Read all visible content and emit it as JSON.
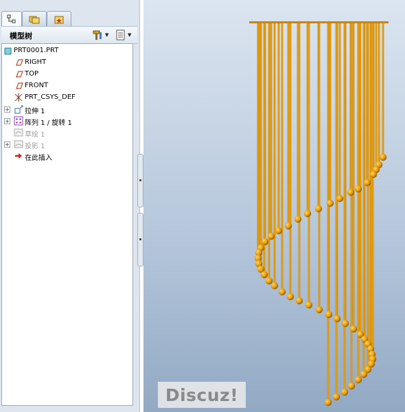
{
  "tabs": [
    {
      "name": "model-tree-tab",
      "icon": "model-tree-icon"
    },
    {
      "name": "folder-browser-tab",
      "icon": "folder-icon"
    },
    {
      "name": "favorites-tab",
      "icon": "favorites-icon"
    }
  ],
  "tree_header": {
    "title": "模型树",
    "settings_icon": "hammer-settings-icon",
    "show_icon": "show-list-icon"
  },
  "tree": {
    "items": [
      {
        "label": "PRT0001.PRT",
        "icon": "part-icon",
        "expander": false,
        "dimmed": false
      },
      {
        "label": "RIGHT",
        "icon": "datum-plane-icon",
        "expander": false,
        "dimmed": false
      },
      {
        "label": "TOP",
        "icon": "datum-plane-icon",
        "expander": false,
        "dimmed": false
      },
      {
        "label": "FRONT",
        "icon": "datum-plane-icon",
        "expander": false,
        "dimmed": false
      },
      {
        "label": "PRT_CSYS_DEF",
        "icon": "csys-icon",
        "expander": false,
        "dimmed": false
      },
      {
        "label": "拉伸 1",
        "icon": "extrude-icon",
        "expander": true,
        "dimmed": false
      },
      {
        "label": "阵列 1 / 旋转 1",
        "icon": "pattern-icon",
        "expander": true,
        "dimmed": false
      },
      {
        "label": "草绘 1",
        "icon": "sketch-icon",
        "expander": false,
        "dimmed": true
      },
      {
        "label": "投影 1",
        "icon": "projection-icon",
        "expander": true,
        "dimmed": true
      },
      {
        "label": "在此插入",
        "icon": "insert-here-arrow-icon",
        "expander": false,
        "dimmed": false
      }
    ]
  },
  "colors": {
    "rod": "#d48a00",
    "rod_highlight": "#f2b020",
    "ball": "#e39a00",
    "viewport_top": "#dbe5f0",
    "viewport_bottom": "#92a9c4"
  },
  "viewport": {
    "model": "spiral-chandelier"
  },
  "watermark": {
    "text": "Discuz!"
  }
}
